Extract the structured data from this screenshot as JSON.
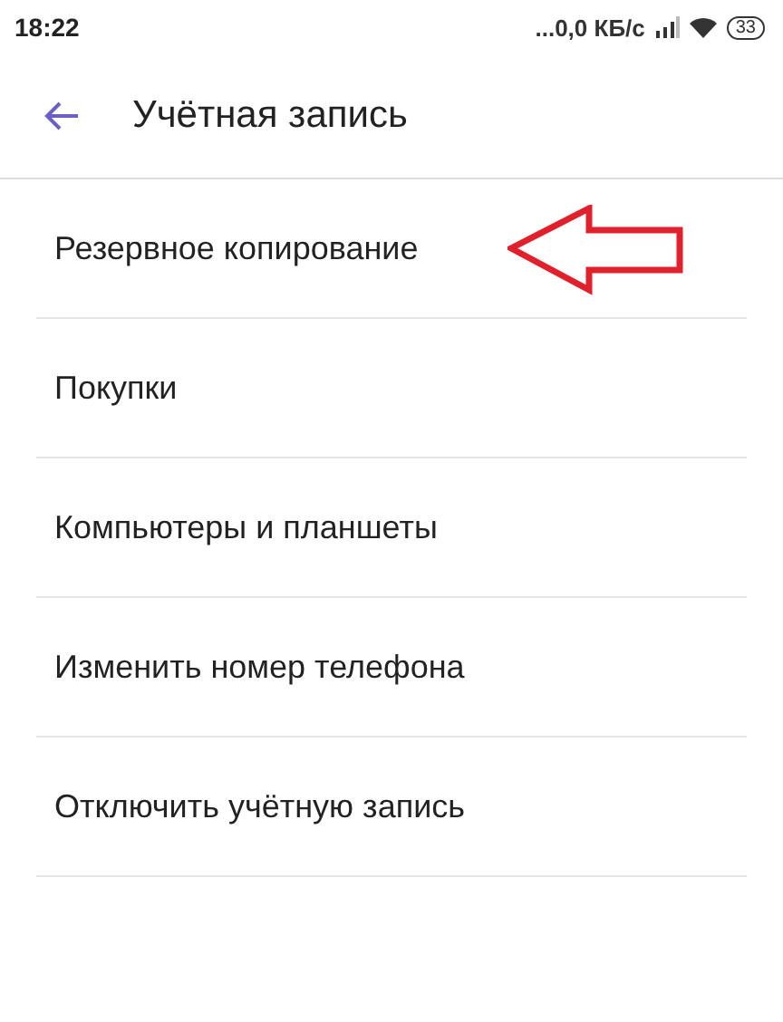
{
  "status_bar": {
    "time": "18:22",
    "network_speed": "...0,0 КБ/с",
    "battery": "33"
  },
  "header": {
    "title": "Учётная запись"
  },
  "items": [
    {
      "label": "Резервное копирование",
      "highlighted": true
    },
    {
      "label": "Покупки",
      "highlighted": false
    },
    {
      "label": "Компьютеры и планшеты",
      "highlighted": false
    },
    {
      "label": "Изменить номер телефона",
      "highlighted": false
    },
    {
      "label": "Отключить учётную запись",
      "highlighted": false
    }
  ]
}
